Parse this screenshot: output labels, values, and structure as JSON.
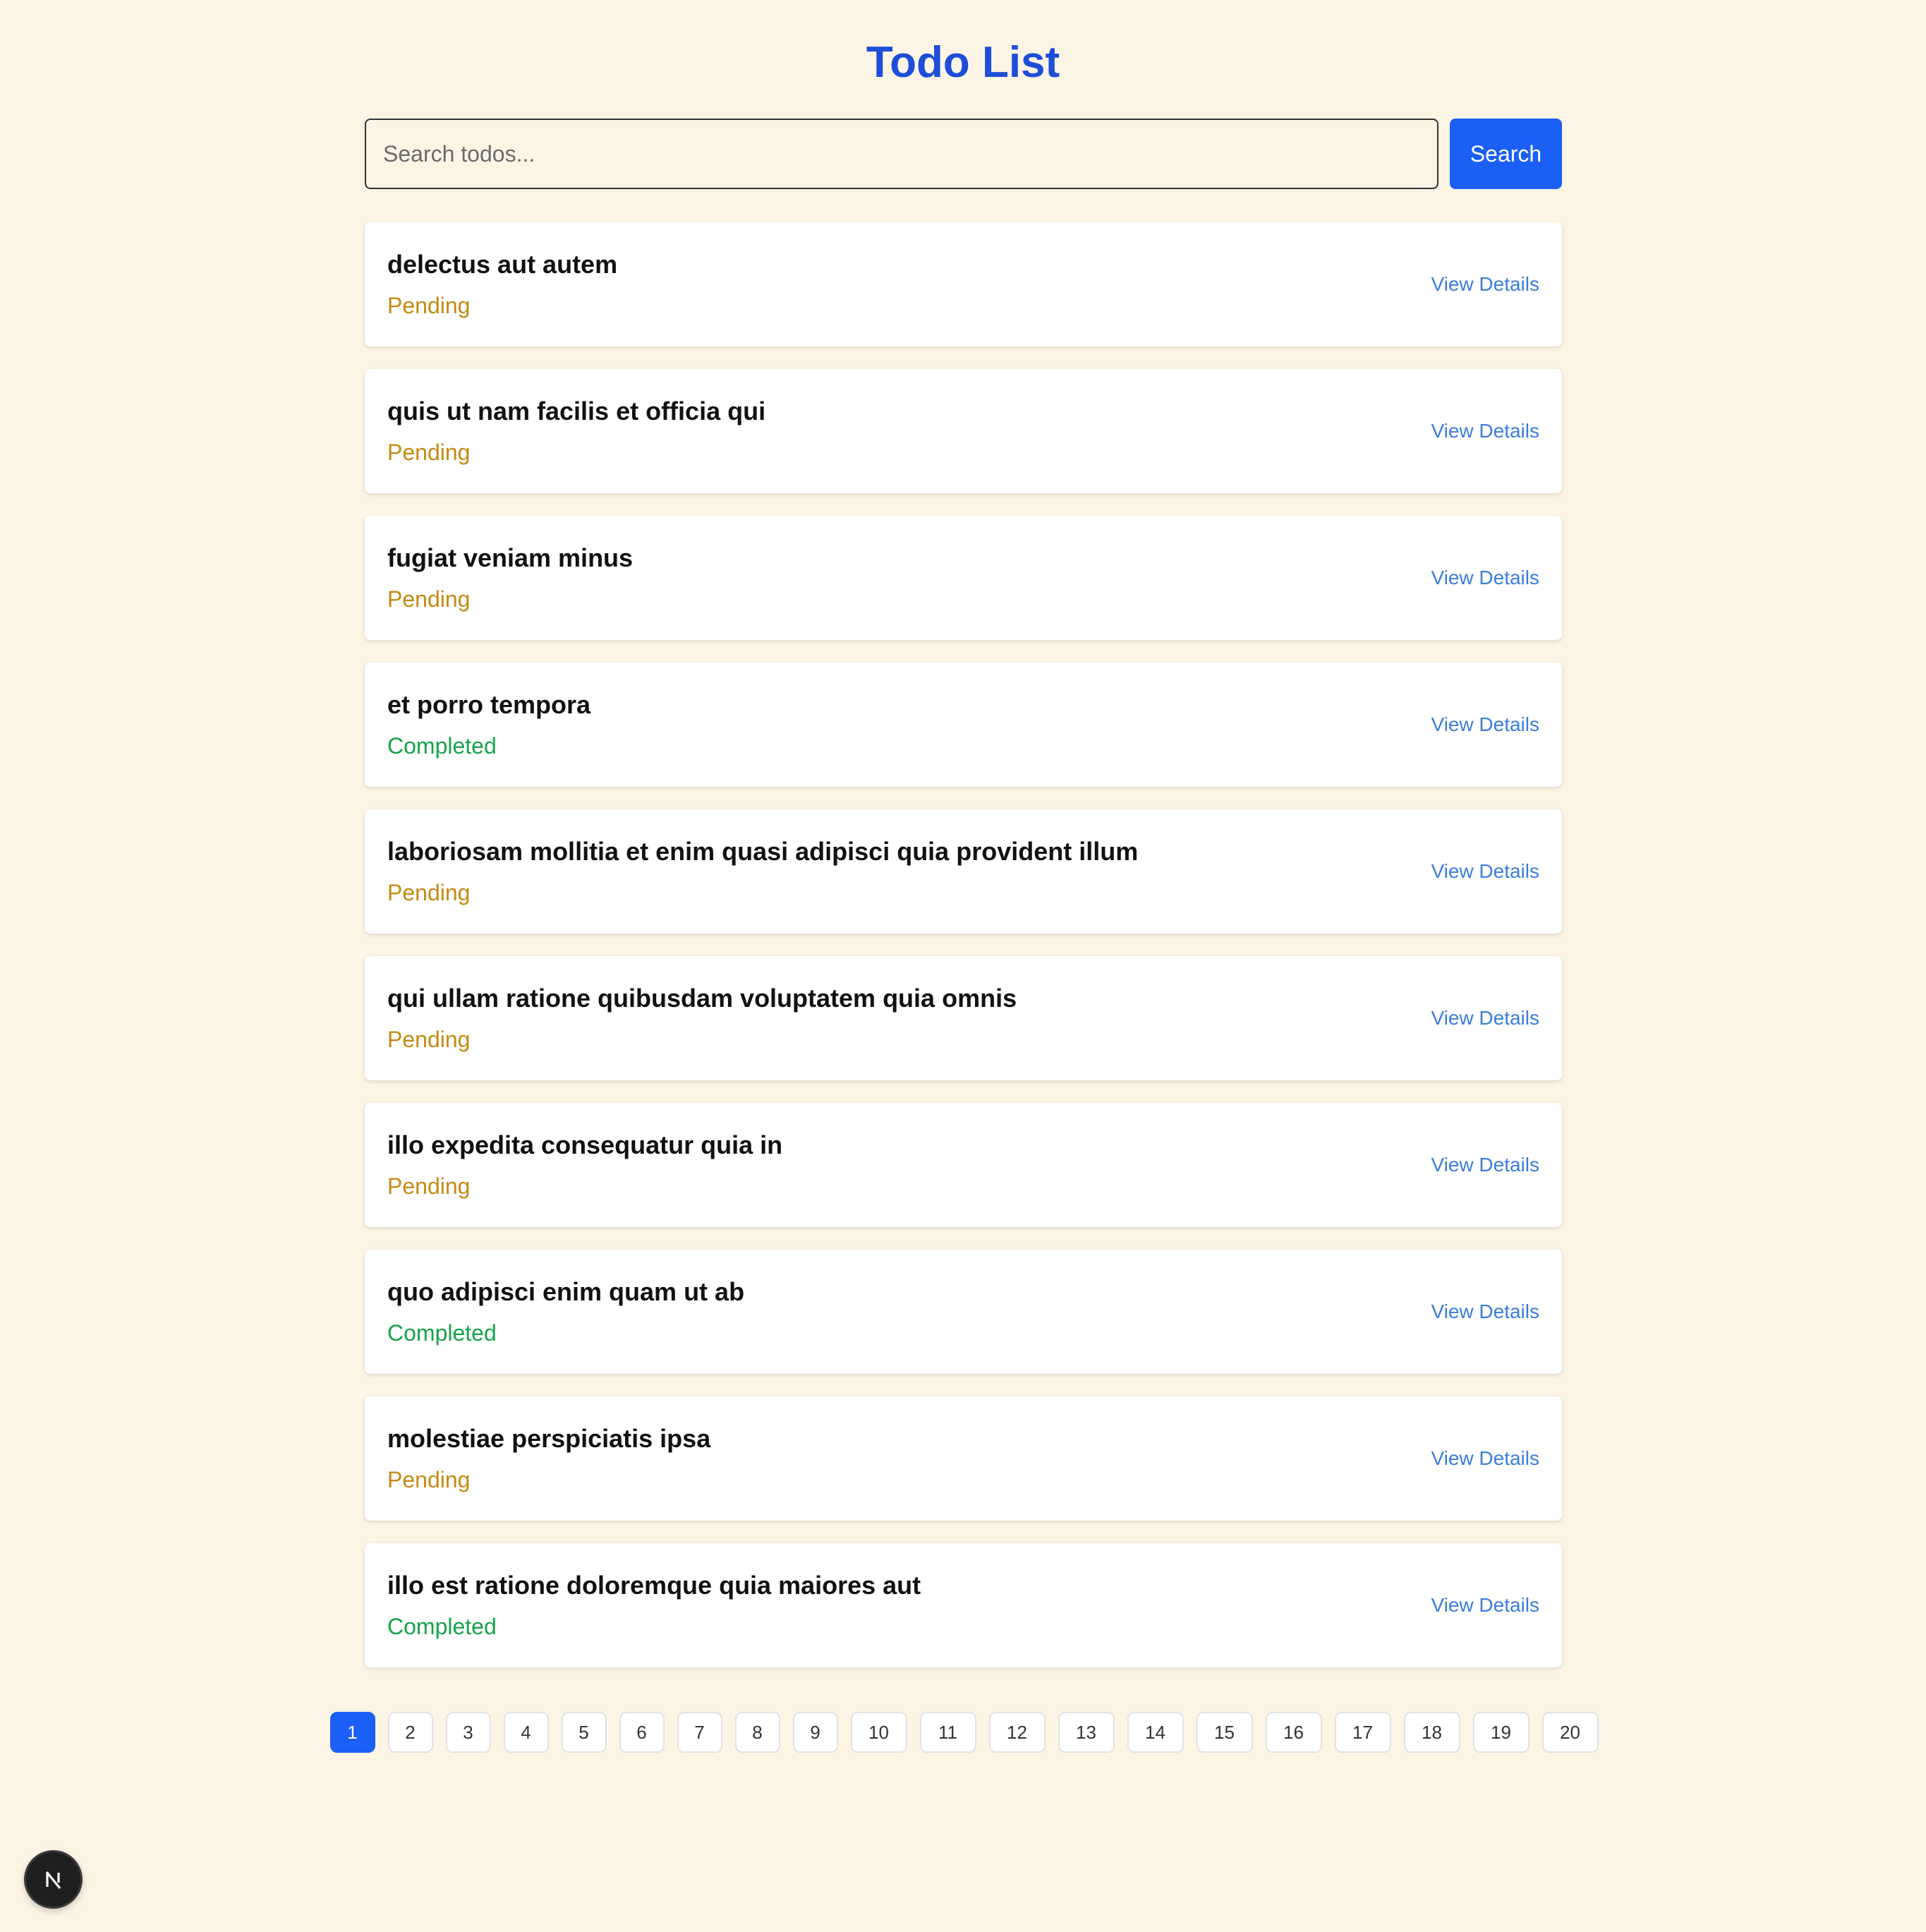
{
  "header": {
    "title": "Todo List"
  },
  "search": {
    "placeholder": "Search todos...",
    "value": "",
    "button_label": "Search"
  },
  "todos": [
    {
      "title": "delectus aut autem",
      "status": "Pending",
      "link": "View Details"
    },
    {
      "title": "quis ut nam facilis et officia qui",
      "status": "Pending",
      "link": "View Details"
    },
    {
      "title": "fugiat veniam minus",
      "status": "Pending",
      "link": "View Details"
    },
    {
      "title": "et porro tempora",
      "status": "Completed",
      "link": "View Details"
    },
    {
      "title": "laboriosam mollitia et enim quasi adipisci quia provident illum",
      "status": "Pending",
      "link": "View Details"
    },
    {
      "title": "qui ullam ratione quibusdam voluptatem quia omnis",
      "status": "Pending",
      "link": "View Details"
    },
    {
      "title": "illo expedita consequatur quia in",
      "status": "Pending",
      "link": "View Details"
    },
    {
      "title": "quo adipisci enim quam ut ab",
      "status": "Completed",
      "link": "View Details"
    },
    {
      "title": "molestiae perspiciatis ipsa",
      "status": "Pending",
      "link": "View Details"
    },
    {
      "title": "illo est ratione doloremque quia maiores aut",
      "status": "Completed",
      "link": "View Details"
    }
  ],
  "pagination": {
    "pages": [
      "1",
      "2",
      "3",
      "4",
      "5",
      "6",
      "7",
      "8",
      "9",
      "10",
      "11",
      "12",
      "13",
      "14",
      "15",
      "16",
      "17",
      "18",
      "19",
      "20"
    ],
    "current": "1"
  },
  "dev_badge": {
    "icon": "next-logo-icon"
  },
  "colors": {
    "background": "#fcf4e5",
    "title": "#1d4ed8",
    "accent": "#1b5ff5",
    "pending": "#c58a12",
    "completed": "#16a34a",
    "link": "#3b7ddd"
  }
}
